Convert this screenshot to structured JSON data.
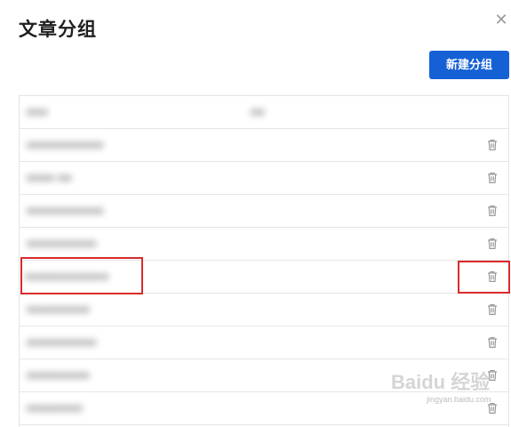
{
  "dialog": {
    "title": "文章分组",
    "close_icon": "close-icon",
    "new_group_label": "新建分组"
  },
  "table": {
    "header": {
      "col1": "■■■",
      "col2": "■■"
    },
    "rows": [
      {
        "name": "■■■■■■■■■■■",
        "highlight": false
      },
      {
        "name": "■■■■ ■■",
        "highlight": false
      },
      {
        "name": "■■■■■■■■■■■",
        "highlight": false
      },
      {
        "name": "■■■■■■■■■■",
        "highlight": false
      },
      {
        "name": "■■■■■■■■■■■■",
        "highlight": true
      },
      {
        "name": "■■■■■■■■■",
        "highlight": false
      },
      {
        "name": "■■■■■■■■■■",
        "highlight": false
      },
      {
        "name": "■■■■■■■■■",
        "highlight": false
      },
      {
        "name": "■■■■■■■■",
        "highlight": false
      }
    ],
    "delete_icon": "trash-icon"
  },
  "colors": {
    "accent": "#1560d4",
    "highlight_border": "#d92b2b"
  },
  "watermark": {
    "brand": "Baidu 经验",
    "url": "jingyan.baidu.com"
  }
}
